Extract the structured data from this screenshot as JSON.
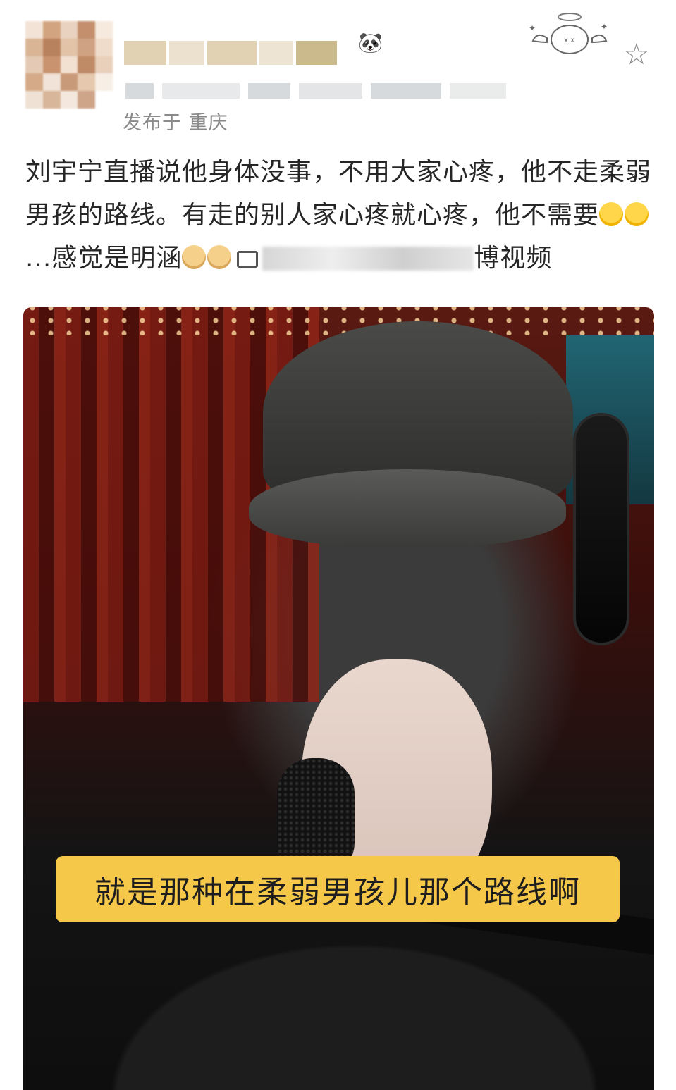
{
  "post": {
    "location": "发布于 重庆",
    "text_main": "刘宇宁直播说他身体没事，不用大家心疼，他不走柔弱男孩的路线。有走的别人家心疼就心疼，他不需要",
    "text_tail": "...感觉是明涵",
    "text_after_link": "博视频"
  },
  "icons": {
    "favorite": "star-icon",
    "angel_sticker": "angel-sticker-icon",
    "emoji_laugh": "laugh-cry-emoji",
    "emoji_doge": "doge-emoji",
    "video_link": "video-link-icon"
  },
  "video": {
    "caption": "就是那种在柔弱男孩儿那个路线啊"
  },
  "colors": {
    "caption_bg": "#f6c84a",
    "text": "#262626",
    "meta": "#8a8a8a"
  }
}
